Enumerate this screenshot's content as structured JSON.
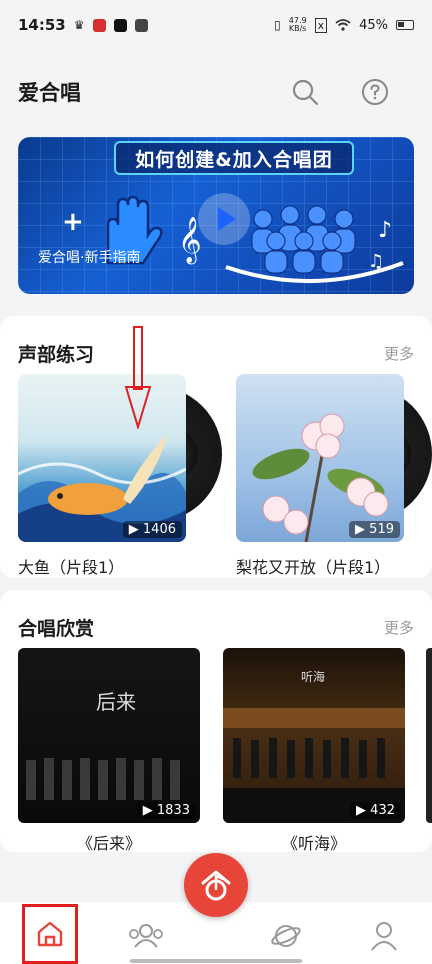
{
  "status_bar": {
    "time": "14:53",
    "network_speed_value": "47.9",
    "network_speed_unit": "KB/s",
    "battery": "45%"
  },
  "header": {
    "title": "爱合唱",
    "icons": [
      "search-icon",
      "help-icon"
    ]
  },
  "banner": {
    "heading": "如何创建&加入合唱团",
    "caption": "爱合唱·新手指南"
  },
  "vocal_practice": {
    "title": "声部练习",
    "more": "更多",
    "items": [
      {
        "label": "大鱼（片段1）",
        "count": "1406"
      },
      {
        "label": "梨花又开放（片段1）",
        "count": "519"
      }
    ]
  },
  "choir_appreciation": {
    "title": "合唱欣赏",
    "more": "更多",
    "items": [
      {
        "label": "《后来》",
        "count": "1833",
        "overlay_text": "后来"
      },
      {
        "label": "《听海》",
        "count": "432",
        "overlay_text": "听海"
      }
    ]
  },
  "tabbar": {
    "tabs": [
      "home-icon",
      "community-icon",
      "record-icon",
      "discover-icon",
      "profile-icon"
    ]
  },
  "colors": {
    "accent_red": "#e8453a",
    "banner_blue": "#1660d4"
  }
}
